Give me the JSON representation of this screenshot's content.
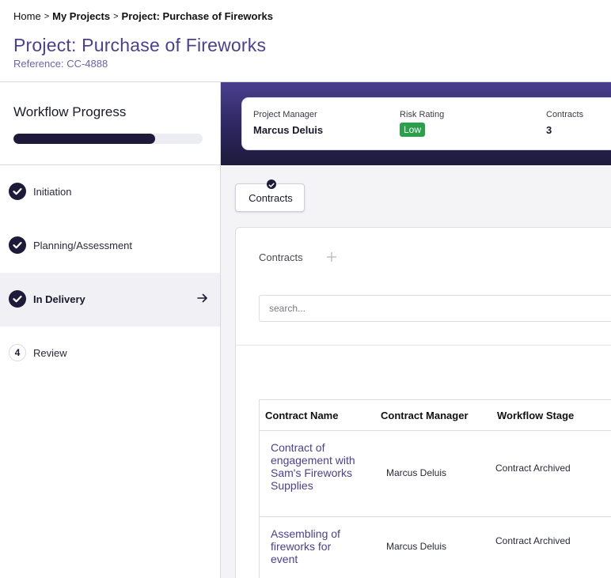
{
  "breadcrumb": {
    "home": "Home",
    "sep": ">",
    "my_projects": "My Projects",
    "current": "Project: Purchase of Fireworks"
  },
  "page": {
    "title": "Project: Purchase of Fireworks",
    "reference": "Reference: CC-4888"
  },
  "sidebar": {
    "progress_title": "Workflow Progress",
    "progress_fraction": 0.75,
    "steps": [
      {
        "label": "Initiation",
        "status": "complete"
      },
      {
        "label": "Planning/Assessment",
        "status": "complete"
      },
      {
        "label": "In Delivery",
        "status": "complete-active"
      },
      {
        "label": "Review",
        "status": "pending",
        "number": "4"
      }
    ]
  },
  "summary": {
    "manager_label": "Project Manager",
    "manager_value": "Marcus Deluis",
    "risk_label": "Risk Rating",
    "risk_value": "Low",
    "contracts_label": "Contracts",
    "contracts_value": "3"
  },
  "tab": {
    "label": "Contracts"
  },
  "panel": {
    "title": "Contracts",
    "search_placeholder": "search..."
  },
  "table": {
    "headers": [
      "Contract Name",
      "Contract Manager",
      "Workflow Stage"
    ],
    "rows": [
      {
        "name": "Contract of engagement with Sam's Fireworks Supplies",
        "manager": "Marcus Deluis",
        "stage": "Contract Archived"
      },
      {
        "name": "Assembling of fireworks for event",
        "manager": "Marcus Deluis",
        "stage": "Contract Archived"
      }
    ]
  },
  "colors": {
    "accent": "#4b3f93",
    "dark": "#1d1a3a",
    "risk_low": "#2aa04a"
  }
}
